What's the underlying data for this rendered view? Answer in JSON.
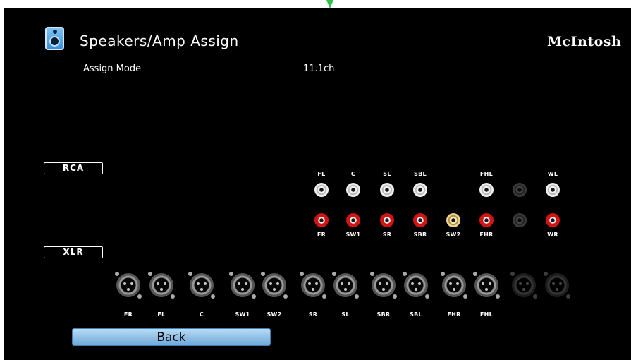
{
  "header": {
    "title": "Speakers/Amp Assign",
    "brand": "McIntosh",
    "icon": "speaker-icon"
  },
  "assign_mode": {
    "label": "Assign Mode",
    "value": "11.1ch"
  },
  "rca": {
    "tag": "RCA",
    "top_labels": [
      "FL",
      "C",
      "SL",
      "SBL",
      "FHL",
      "WL"
    ],
    "bottom_labels": [
      "FR",
      "SW1",
      "SR",
      "SBR",
      "SW2",
      "FHR",
      "WR"
    ],
    "top_jacks": [
      "white",
      "white",
      "white",
      "white",
      "white",
      "dark",
      "white"
    ],
    "bottom_jacks": [
      "red",
      "red",
      "red",
      "red",
      "gold",
      "red",
      "dark",
      "red"
    ]
  },
  "xlr": {
    "tag": "XLR",
    "labels": [
      "FR",
      "FL",
      "C",
      "SW1",
      "SW2",
      "SR",
      "SL",
      "SBR",
      "SBL",
      "FHR",
      "FHL"
    ]
  },
  "back_label": "Back",
  "colors": {
    "background": "#000000",
    "button": "#8ec0ea",
    "red_jack": "#d31414",
    "marker": "#2fbf4a"
  }
}
